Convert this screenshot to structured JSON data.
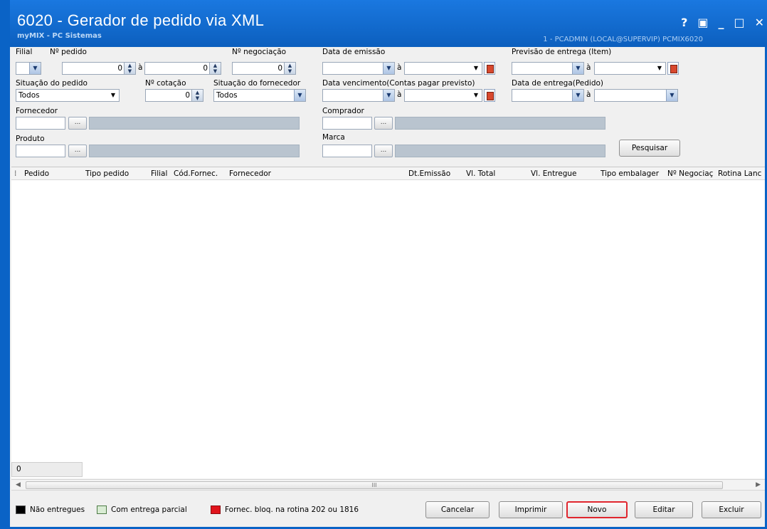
{
  "window": {
    "title": "6020 - Gerador de pedido via XML",
    "subtitle": "myMIX - PC Sistemas",
    "user_info": "1 - PCADMIN (LOCAL@SUPERVIP)   PCMIX6020",
    "controls": {
      "help": "?",
      "restore": "▣",
      "minimize": "_",
      "maximize": "□",
      "close": "✕"
    }
  },
  "filters": {
    "filial": {
      "label": "Filial",
      "value": ""
    },
    "pedido": {
      "label": "Nº pedido",
      "from": "0",
      "to": "0",
      "sep": "à"
    },
    "negociacao": {
      "label": "Nº negociação",
      "value": "0"
    },
    "emissao": {
      "label": "Data de emissão",
      "from": "",
      "to": "",
      "sep": "à"
    },
    "previsao": {
      "label": "Previsão  de entrega (Item)",
      "from": "",
      "to": "",
      "sep": "à"
    },
    "situacao_pedido": {
      "label": "Situação do pedido",
      "value": "Todos"
    },
    "cotacao": {
      "label": "Nº cotação",
      "value": "0"
    },
    "situacao_fornecedor": {
      "label": "Situação do fornecedor",
      "value": "Todos"
    },
    "vencimento": {
      "label": "Data vencimento(Contas pagar previsto)",
      "from": "",
      "to": "",
      "sep": "à"
    },
    "entrega_pedido": {
      "label": "Data de entrega(Pedido)",
      "from": "",
      "to": "",
      "sep": "à"
    },
    "fornecedor": {
      "label": "Fornecedor",
      "code": "",
      "name": ""
    },
    "comprador": {
      "label": "Comprador",
      "code": "",
      "name": ""
    },
    "produto": {
      "label": "Produto",
      "code": "",
      "name": ""
    },
    "marca": {
      "label": "Marca",
      "code": "",
      "name": ""
    },
    "ellipsis": "...",
    "search_label": "Pesquisar"
  },
  "grid": {
    "columns": [
      "Pedido",
      "Tipo pedido",
      "Filial",
      "Cód.Fornec.",
      "Fornecedor",
      "Dt.Emissão",
      "Vl. Total",
      "Vl. Entregue",
      "Tipo embalager",
      "Nº Negociaç",
      "Rotina Lanc"
    ],
    "row_count": "0",
    "scroll_grip": "III"
  },
  "legend": {
    "items": [
      {
        "label": "Não entregues",
        "color": "#000000"
      },
      {
        "label": "Com entrega parcial",
        "color": "#d9ecd4"
      },
      {
        "label": "Fornec. bloq. na rotina 202 ou 1816",
        "color": "#e0141c"
      }
    ]
  },
  "buttons": {
    "cancelar": "Cancelar",
    "imprimir": "Imprimir",
    "novo": "Novo",
    "editar": "Editar",
    "excluir": "Excluir"
  },
  "colors": {
    "title_bar": "#0c5fbe",
    "highlight": "#e0262e",
    "disabled_field": "#b9c4cf"
  }
}
